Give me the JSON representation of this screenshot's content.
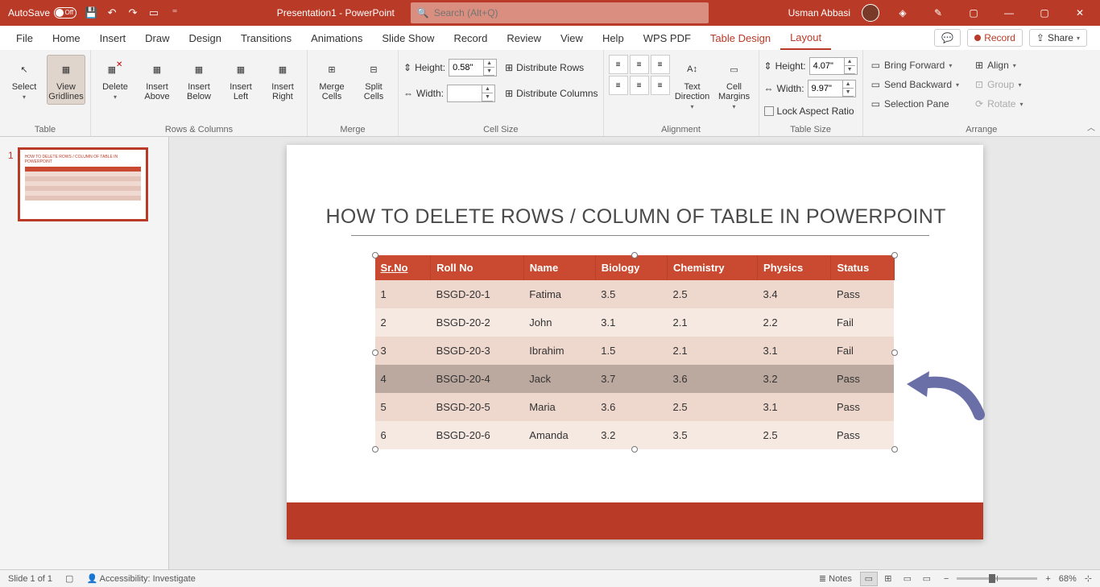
{
  "titlebar": {
    "autosave": "AutoSave",
    "toggle_state": "Off",
    "doc_title": "Presentation1 - PowerPoint",
    "search_placeholder": "Search (Alt+Q)",
    "user": "Usman Abbasi"
  },
  "tabs": {
    "items": [
      "File",
      "Home",
      "Insert",
      "Draw",
      "Design",
      "Transitions",
      "Animations",
      "Slide Show",
      "Record",
      "Review",
      "View",
      "Help",
      "WPS PDF",
      "Table Design",
      "Layout"
    ],
    "active": "Layout",
    "comments": "",
    "record": "Record",
    "share": "Share"
  },
  "ribbon": {
    "table": {
      "label": "Table",
      "select": "Select",
      "view_gridlines": "View Gridlines"
    },
    "rows_cols": {
      "label": "Rows & Columns",
      "delete": "Delete",
      "insert_above": "Insert Above",
      "insert_below": "Insert Below",
      "insert_left": "Insert Left",
      "insert_right": "Insert Right"
    },
    "merge": {
      "label": "Merge",
      "merge_cells": "Merge Cells",
      "split_cells": "Split Cells"
    },
    "cell_size": {
      "label": "Cell Size",
      "height": "Height:",
      "height_val": "0.58\"",
      "width": "Width:",
      "width_val": "",
      "dist_rows": "Distribute Rows",
      "dist_cols": "Distribute Columns"
    },
    "alignment": {
      "label": "Alignment",
      "text_direction": "Text Direction",
      "cell_margins": "Cell Margins"
    },
    "table_size": {
      "label": "Table Size",
      "height": "Height:",
      "height_val": "4.07\"",
      "width": "Width:",
      "width_val": "9.97\"",
      "lock": "Lock Aspect Ratio"
    },
    "arrange": {
      "label": "Arrange",
      "bring_forward": "Bring Forward",
      "send_backward": "Send Backward",
      "selection_pane": "Selection Pane",
      "align": "Align",
      "group": "Group",
      "rotate": "Rotate"
    }
  },
  "slide": {
    "title": "HOW TO DELETE  ROWS / COLUMN OF TABLE IN POWERPOINT",
    "headers": [
      "Sr.No",
      "Roll No",
      "Name",
      "Biology",
      "Chemistry",
      "Physics",
      "Status"
    ],
    "rows": [
      {
        "sr": "1",
        "roll": "BSGD-20-1",
        "name": "Fatima",
        "bio": "3.5",
        "chem": "2.5",
        "phy": "3.4",
        "status": "Pass"
      },
      {
        "sr": "2",
        "roll": "BSGD-20-2",
        "name": "John",
        "bio": "3.1",
        "chem": "2.1",
        "phy": "2.2",
        "status": "Fail"
      },
      {
        "sr": "3",
        "roll": "BSGD-20-3",
        "name": "Ibrahim",
        "bio": "1.5",
        "chem": "2.1",
        "phy": "3.1",
        "status": "Fail"
      },
      {
        "sr": "4",
        "roll": "BSGD-20-4",
        "name": "Jack",
        "bio": "3.7",
        "chem": "3.6",
        "phy": "3.2",
        "status": "Pass"
      },
      {
        "sr": "5",
        "roll": "BSGD-20-5",
        "name": "Maria",
        "bio": "3.6",
        "chem": "2.5",
        "phy": "3.1",
        "status": "Pass"
      },
      {
        "sr": "6",
        "roll": "BSGD-20-6",
        "name": "Amanda",
        "bio": "3.2",
        "chem": "3.5",
        "phy": "2.5",
        "status": "Pass"
      }
    ],
    "selected_row": 3
  },
  "status": {
    "slide_info": "Slide 1 of 1",
    "accessibility": "Accessibility: Investigate",
    "notes": "Notes",
    "zoom": "68%"
  },
  "thumb": {
    "num": "1"
  }
}
